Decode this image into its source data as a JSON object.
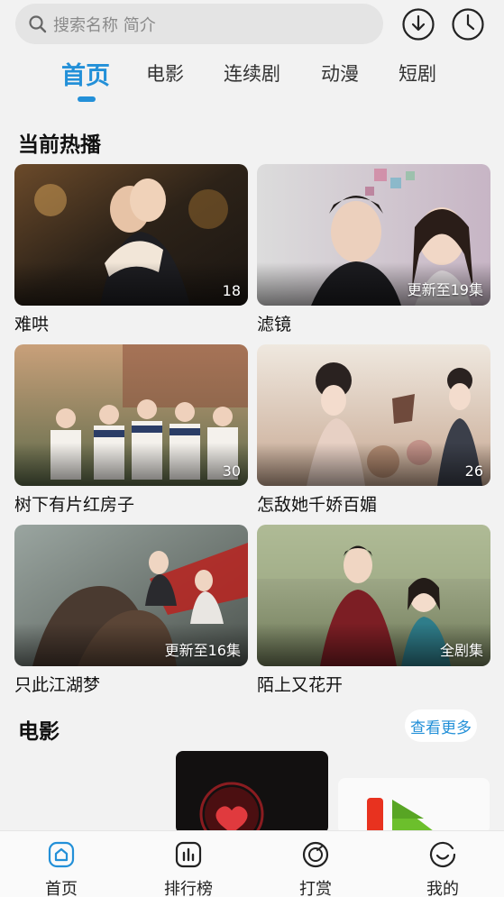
{
  "search": {
    "placeholder": "搜索名称 简介",
    "icon": "search-icon"
  },
  "top_actions": [
    {
      "name": "download-icon"
    },
    {
      "name": "history-clock-icon"
    }
  ],
  "tabs": [
    {
      "label": "首页",
      "active": true
    },
    {
      "label": "电影",
      "active": false
    },
    {
      "label": "连续剧",
      "active": false
    },
    {
      "label": "动漫",
      "active": false
    },
    {
      "label": "短剧",
      "active": false
    }
  ],
  "hot": {
    "title": "当前热播",
    "items": [
      {
        "title": "难哄",
        "badge": "18"
      },
      {
        "title": "滤镜",
        "badge": "更新至19集"
      },
      {
        "title": "树下有片红房子",
        "badge": "30"
      },
      {
        "title": "怎敌她千娇百媚",
        "badge": "26"
      },
      {
        "title": "只此江湖梦",
        "badge": "更新至16集"
      },
      {
        "title": "陌上又花开",
        "badge": "全剧集"
      }
    ]
  },
  "movies": {
    "title": "电影",
    "more_label": "查看更多"
  },
  "bottom_nav": [
    {
      "label": "首页",
      "icon": "home-icon",
      "active": true
    },
    {
      "label": "排行榜",
      "icon": "ranking-chart-icon",
      "active": false
    },
    {
      "label": "打赏",
      "icon": "reward-coin-icon",
      "active": false
    },
    {
      "label": "我的",
      "icon": "profile-smile-icon",
      "active": false
    }
  ],
  "colors": {
    "accent": "#2390d8",
    "background": "#f2f2f2"
  }
}
